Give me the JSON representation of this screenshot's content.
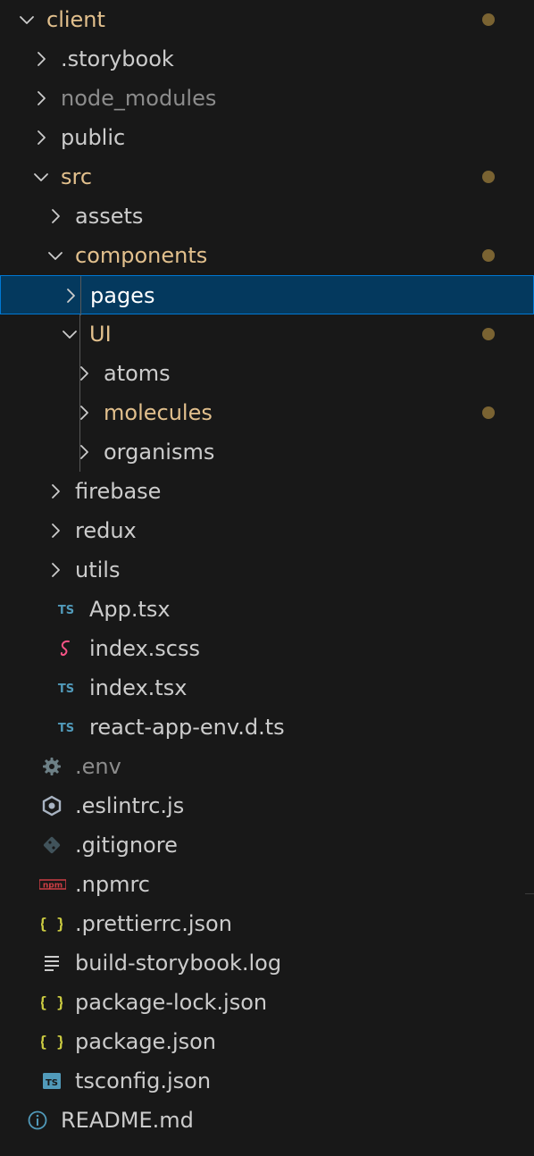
{
  "colors": {
    "background": "#181818",
    "text": "#cccccc",
    "modified_text": "#e2c08d",
    "ignored_text": "#8c8c8c",
    "selected_background": "#04395e",
    "selected_border": "#0078d4",
    "modified_dot": "#7a6332",
    "ts_icon": "#519aba",
    "sass_icon": "#f55385",
    "json_icon": "#cbcb41",
    "npm_icon": "#cc3e44",
    "git_icon": "#41535b",
    "muted_icon": "#6d8086"
  },
  "explorer": {
    "items": [
      {
        "label": "client",
        "kind": "folder",
        "depth": 0,
        "expanded": true,
        "modified": true
      },
      {
        "label": ".storybook",
        "kind": "folder",
        "depth": 1,
        "expanded": false
      },
      {
        "label": "node_modules",
        "kind": "folder",
        "depth": 1,
        "expanded": false,
        "ignored": true
      },
      {
        "label": "public",
        "kind": "folder",
        "depth": 1,
        "expanded": false
      },
      {
        "label": "src",
        "kind": "folder",
        "depth": 1,
        "expanded": true,
        "modified": true
      },
      {
        "label": "assets",
        "kind": "folder",
        "depth": 2,
        "expanded": false
      },
      {
        "label": "components",
        "kind": "folder",
        "depth": 2,
        "expanded": true,
        "modified": true
      },
      {
        "label": "pages",
        "kind": "folder",
        "depth": 3,
        "expanded": false,
        "selected": true
      },
      {
        "label": "UI",
        "kind": "folder",
        "depth": 3,
        "expanded": true,
        "modified": true
      },
      {
        "label": "atoms",
        "kind": "folder",
        "depth": 4,
        "expanded": false
      },
      {
        "label": "molecules",
        "kind": "folder",
        "depth": 4,
        "expanded": false,
        "modified": true
      },
      {
        "label": "organisms",
        "kind": "folder",
        "depth": 4,
        "expanded": false
      },
      {
        "label": "firebase",
        "kind": "folder",
        "depth": 2,
        "expanded": false
      },
      {
        "label": "redux",
        "kind": "folder",
        "depth": 2,
        "expanded": false
      },
      {
        "label": "utils",
        "kind": "folder",
        "depth": 2,
        "expanded": false
      },
      {
        "label": "App.tsx",
        "kind": "file",
        "depth": 2,
        "icon": "typescript-icon",
        "icon_text": "TS"
      },
      {
        "label": "index.scss",
        "kind": "file",
        "depth": 2,
        "icon": "sass-icon"
      },
      {
        "label": "index.tsx",
        "kind": "file",
        "depth": 2,
        "icon": "typescript-icon",
        "icon_text": "TS"
      },
      {
        "label": "react-app-env.d.ts",
        "kind": "file",
        "depth": 2,
        "icon": "typescript-icon",
        "icon_text": "TS"
      },
      {
        "label": ".env",
        "kind": "file",
        "depth": 1,
        "icon": "gear-icon",
        "ignored": true
      },
      {
        "label": ".eslintrc.js",
        "kind": "file",
        "depth": 1,
        "icon": "eslint-icon"
      },
      {
        "label": ".gitignore",
        "kind": "file",
        "depth": 1,
        "icon": "git-icon"
      },
      {
        "label": ".npmrc",
        "kind": "file",
        "depth": 1,
        "icon": "npm-icon",
        "icon_text": "npm"
      },
      {
        "label": ".prettierrc.json",
        "kind": "file",
        "depth": 1,
        "icon": "json-icon",
        "icon_text": "{ }"
      },
      {
        "label": "build-storybook.log",
        "kind": "file",
        "depth": 1,
        "icon": "log-file-icon"
      },
      {
        "label": "package-lock.json",
        "kind": "file",
        "depth": 1,
        "icon": "json-icon",
        "icon_text": "{ }"
      },
      {
        "label": "package.json",
        "kind": "file",
        "depth": 1,
        "icon": "json-icon",
        "icon_text": "{ }"
      },
      {
        "label": "tsconfig.json",
        "kind": "file",
        "depth": 1,
        "icon": "tsconfig-icon",
        "icon_text": "TS"
      },
      {
        "label": "README.md",
        "kind": "file",
        "depth": 0,
        "icon": "info-icon"
      }
    ]
  }
}
